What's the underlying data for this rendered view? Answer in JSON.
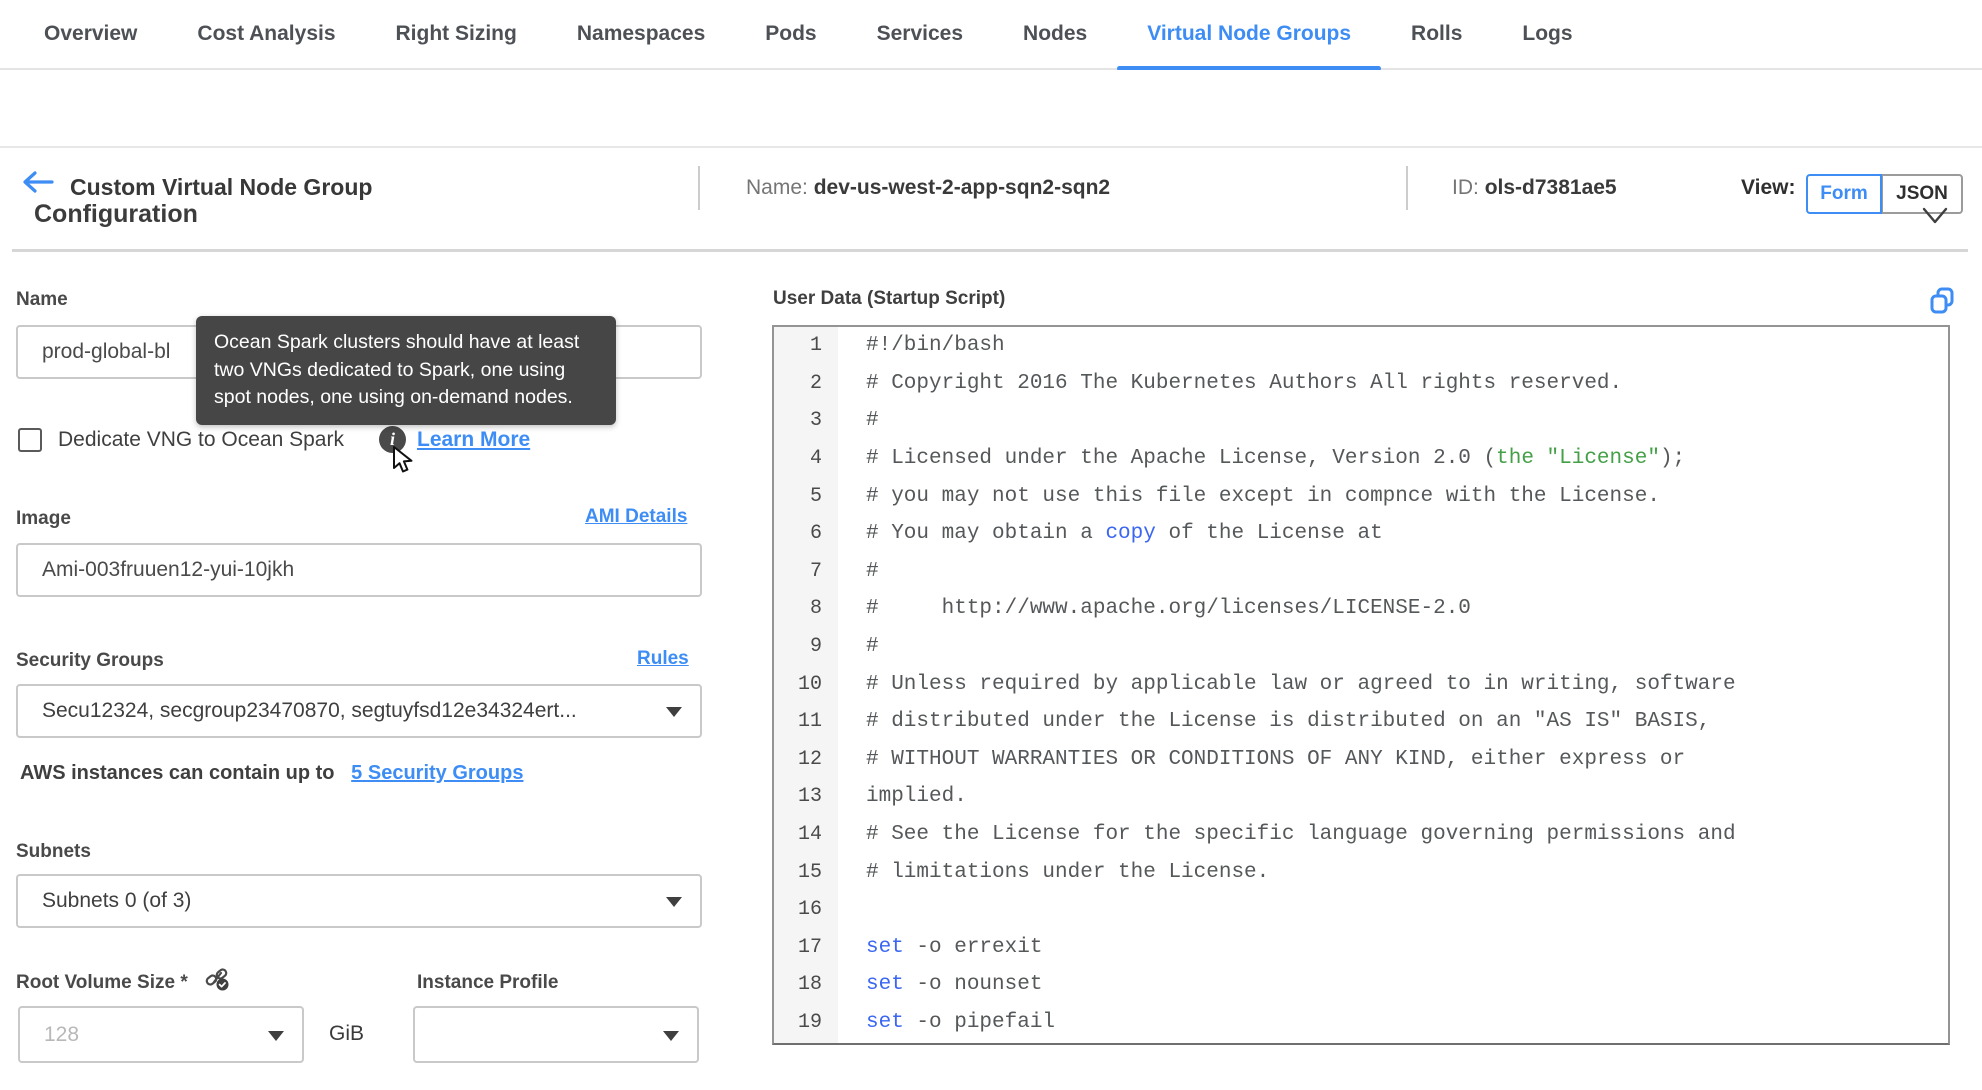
{
  "nav": {
    "tabs": [
      "Overview",
      "Cost Analysis",
      "Right Sizing",
      "Namespaces",
      "Pods",
      "Services",
      "Nodes",
      "Virtual Node Groups",
      "Rolls",
      "Logs"
    ],
    "active_tab": "Virtual Node Groups"
  },
  "header": {
    "title": "Custom Virtual Node Group",
    "name_label": "Name:",
    "name_value": "dev-us-west-2-app-sqn2-sqn2",
    "id_label": "ID:",
    "id_value": "ols-d7381ae5",
    "view_label": "View:",
    "view_form": "Form",
    "view_json": "JSON",
    "view_active": "Form"
  },
  "section": {
    "title": "Configuration"
  },
  "form": {
    "name": {
      "label": "Name",
      "value": "prod-global-bl"
    },
    "tooltip": {
      "text": "Ocean Spark clusters should have at least two VNGs dedicated to Spark, one using spot nodes, one using on-demand nodes."
    },
    "dedicate": {
      "label": "Dedicate VNG to Ocean Spark",
      "checked": false,
      "learn_more": "Learn More"
    },
    "image": {
      "label": "Image",
      "link": "AMI Details",
      "value": "Ami-003fruuen12-yui-10jkh"
    },
    "security_groups": {
      "label": "Security Groups",
      "link": "Rules",
      "value": "Secu12324, secgroup23470870, segtuyfsd12e34324ert...",
      "note_text": "AWS instances can contain up to",
      "note_link": "5 Security Groups"
    },
    "subnets": {
      "label": "Subnets",
      "value": "Subnets 0 (of 3)"
    },
    "root_volume": {
      "label": "Root Volume Size *",
      "placeholder": "128",
      "unit": "GiB"
    },
    "instance_profile": {
      "label": "Instance Profile",
      "value": ""
    }
  },
  "editor": {
    "title": "User Data (Startup Script)",
    "lines": [
      {
        "n": "1",
        "segs": [
          {
            "t": "#!/bin/bash"
          }
        ]
      },
      {
        "n": "2",
        "segs": [
          {
            "t": "# Copyright 2016 The Kubernetes Authors All rights reserved."
          }
        ]
      },
      {
        "n": "3",
        "segs": [
          {
            "t": "#"
          }
        ]
      },
      {
        "n": "4",
        "segs": [
          {
            "t": "# Licensed under the Apache License, Version 2.0 ("
          },
          {
            "t": "the \"License\"",
            "c": "green"
          },
          {
            "t": ");"
          }
        ]
      },
      {
        "n": "5",
        "segs": [
          {
            "t": "# you may not use this file except in compnce with the License."
          }
        ]
      },
      {
        "n": "6",
        "segs": [
          {
            "t": "# You may obtain a "
          },
          {
            "t": "copy",
            "c": "blue"
          },
          {
            "t": " of the License at"
          }
        ]
      },
      {
        "n": "7",
        "segs": [
          {
            "t": "#"
          }
        ]
      },
      {
        "n": "8",
        "segs": [
          {
            "t": "#     http://www.apache.org/licenses/LICENSE-2.0"
          }
        ]
      },
      {
        "n": "9",
        "segs": [
          {
            "t": "#"
          }
        ]
      },
      {
        "n": "10",
        "segs": [
          {
            "t": "# Unless required by applicable law or agreed to in writing, software"
          }
        ]
      },
      {
        "n": "11",
        "segs": [
          {
            "t": "# distributed under the License is distributed on an \"AS IS\" BASIS,"
          }
        ]
      },
      {
        "n": "12",
        "segs": [
          {
            "t": "# WITHOUT WARRANTIES OR CONDITIONS OF ANY KIND, either express or"
          }
        ]
      },
      {
        "n": "13",
        "segs": [
          {
            "t": "implied."
          }
        ]
      },
      {
        "n": "14",
        "segs": [
          {
            "t": "# See the License for the specific language governing permissions and"
          }
        ]
      },
      {
        "n": "15",
        "segs": [
          {
            "t": "# limitations under the License."
          }
        ]
      },
      {
        "n": "16",
        "segs": [
          {
            "t": ""
          }
        ]
      },
      {
        "n": "17",
        "segs": [
          {
            "t": "set",
            "c": "blue"
          },
          {
            "t": " -o errexit"
          }
        ]
      },
      {
        "n": "18",
        "segs": [
          {
            "t": "set",
            "c": "blue"
          },
          {
            "t": " -o nounset"
          }
        ]
      },
      {
        "n": "19",
        "segs": [
          {
            "t": "set",
            "c": "blue"
          },
          {
            "t": " -o pipefail"
          }
        ]
      }
    ]
  },
  "colors": {
    "accent_blue": "#3d8df5",
    "tooltip_bg": "#464646",
    "code_comment": "#55585a",
    "code_green": "#43a047",
    "code_blue": "#3a66f2",
    "gutter_bg": "#f5f5f5"
  }
}
